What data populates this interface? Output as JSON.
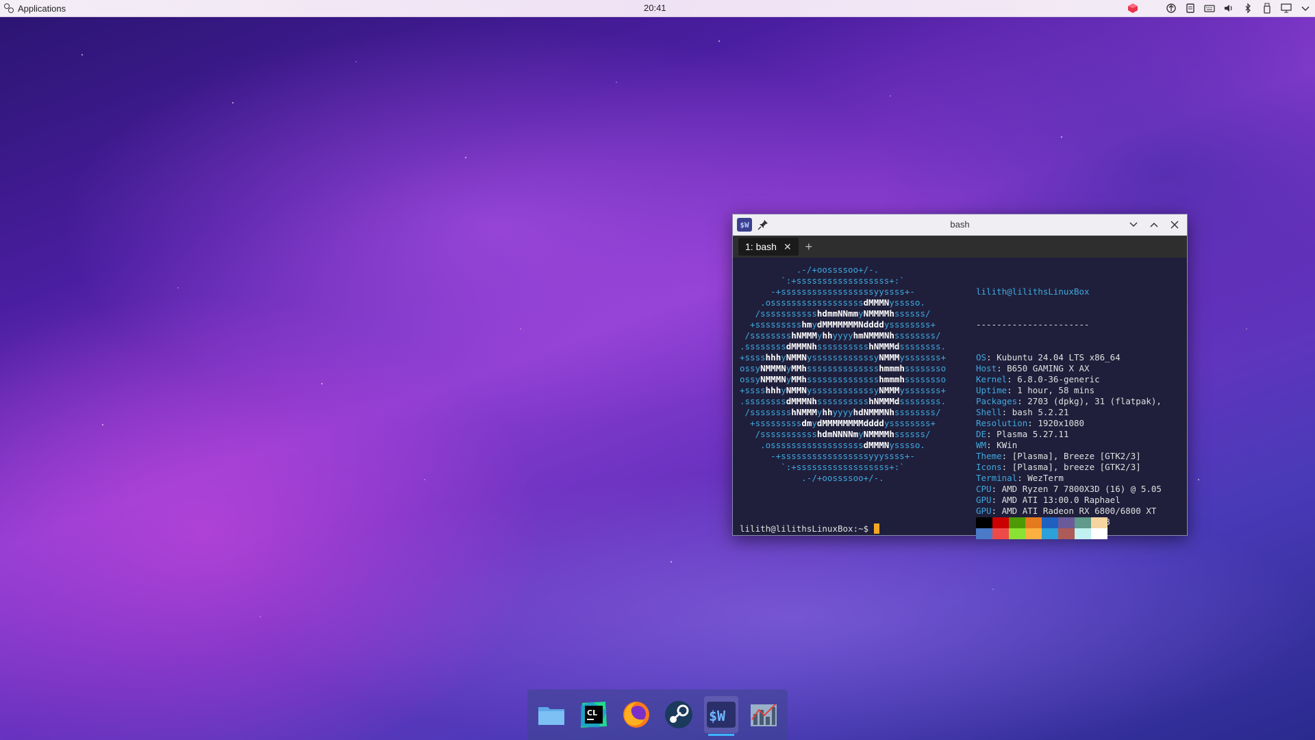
{
  "panel": {
    "applications_label": "Applications",
    "clock": "20:41",
    "tray_icons": [
      "color-app-icon",
      "battery-icon",
      "network-icon",
      "clipboard-icon",
      "keyboard-icon",
      "volume-icon",
      "bluetooth-icon",
      "usb-icon",
      "display-icon",
      "chevron-down-icon"
    ]
  },
  "window": {
    "title": "bash",
    "badge": "$W",
    "tabs": [
      {
        "label": "1: bash"
      }
    ],
    "add_tab": "+"
  },
  "neofetch": {
    "header": "lilith@lilithsLinuxBox",
    "separator": "----------------------",
    "rows": [
      {
        "key": "OS",
        "value": "Kubuntu 24.04 LTS x86_64"
      },
      {
        "key": "Host",
        "value": "B650 GAMING X AX"
      },
      {
        "key": "Kernel",
        "value": "6.8.0-36-generic"
      },
      {
        "key": "Uptime",
        "value": "1 hour, 58 mins"
      },
      {
        "key": "Packages",
        "value": "2703 (dpkg), 31 (flatpak),"
      },
      {
        "key": "Shell",
        "value": "bash 5.2.21"
      },
      {
        "key": "Resolution",
        "value": "1920x1080"
      },
      {
        "key": "DE",
        "value": "Plasma 5.27.11"
      },
      {
        "key": "WM",
        "value": "KWin"
      },
      {
        "key": "Theme",
        "value": "[Plasma], Breeze [GTK2/3]"
      },
      {
        "key": "Icons",
        "value": "[Plasma], breeze [GTK2/3]"
      },
      {
        "key": "Terminal",
        "value": "WezTerm"
      },
      {
        "key": "CPU",
        "value": "AMD Ryzen 7 7800X3D (16) @ 5.05"
      },
      {
        "key": "GPU",
        "value": "AMD ATI 13:00.0 Raphael"
      },
      {
        "key": "GPU",
        "value": "AMD ATI Radeon RX 6800/6800 XT"
      },
      {
        "key": "Memory",
        "value": "4061MiB / 31228MiB"
      }
    ],
    "palette": [
      "#000000",
      "#cc0000",
      "#4e9a06",
      "#e5791e",
      "#2060c0",
      "#6a5a9a",
      "#5f9a8a",
      "#f5d5a0",
      "#4a7ac8",
      "#ef4a4a",
      "#8ae234",
      "#fcb040",
      "#2ca0d8",
      "#ad5a58",
      "#c0f0f0",
      "#ffffff"
    ],
    "logo_lines": [
      "           .-/+oossssoo+/-.",
      "        `:+ssssssssssssssssss+:`",
      "      -+ssssssssssssssssssyyssss+-",
      "    .ossssssssssssssssssdMMMNysssso.",
      "   /ssssssssssshdmmNNmmyNMMMMhssssss/",
      "  +ssssssssshmydMMMMMMMNddddyssssssss+",
      " /sssssssshNMMMyhhyyyyhmNMMMNhssssssss/",
      ".ssssssssdMMMNhsssssssssshNMMMdssssssss.",
      "+sssshhhyNMMNyssssssssssssyNMMMysssssss+",
      "ossyNMMMNyMMhsssssssssssssshmmmhssssssso",
      "ossyNMMMNyMMhsssssssssssssshmmmhssssssso",
      "+sssshhhyNMMNyssssssssssssyNMMMysssssss+",
      ".ssssssssdMMMNhsssssssssshNMMMdssssssss.",
      " /sssssssshNMMMyhhyyyyhdNMMMNhssssssss/",
      "  +sssssssssdmydMMMMMMMMddddyssssssss+",
      "   /ssssssssssshdmNNNNmyNMMMMhssssss/",
      "    .ossssssssssssssssssdMMMNysssso.",
      "      -+sssssssssssssssssyyyssss+-",
      "        `:+ssssssssssssssssss+:`",
      "            .-/+oossssoo+/-."
    ]
  },
  "prompt": "lilith@lilithsLinuxBox:~$ ",
  "dock": [
    {
      "name": "file-manager"
    },
    {
      "name": "clion",
      "label": "CL"
    },
    {
      "name": "firefox"
    },
    {
      "name": "steam"
    },
    {
      "name": "wezterm",
      "label": "$W"
    },
    {
      "name": "system-monitor"
    }
  ]
}
